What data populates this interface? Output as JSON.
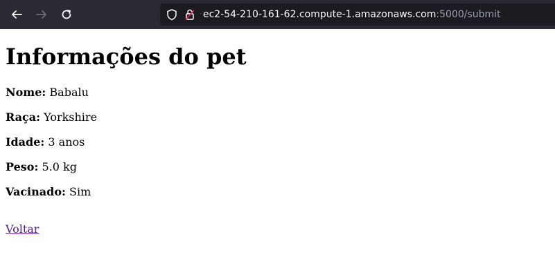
{
  "browser": {
    "url_host": "ec2-54-210-161-62.compute-1.amazonaws.com",
    "url_path": ":5000/submit",
    "icons": {
      "back": "arrow-left-icon",
      "forward": "arrow-right-icon",
      "reload": "reload-icon",
      "tracking": "shield-icon",
      "connection": "lock-icon"
    }
  },
  "page": {
    "title": "Informações do pet",
    "fields": [
      {
        "label": "Nome:",
        "value": "Babalu"
      },
      {
        "label": "Raça:",
        "value": "Yorkshire"
      },
      {
        "label": "Idade:",
        "value": "3 anos"
      },
      {
        "label": "Peso:",
        "value": "5.0 kg"
      },
      {
        "label": "Vacinado:",
        "value": "Sim"
      }
    ],
    "back_link": "Voltar"
  },
  "colors": {
    "toolbar_bg": "#2b2a33",
    "urlbar_bg": "#1c1b22",
    "visited_link": "#551a8b"
  }
}
